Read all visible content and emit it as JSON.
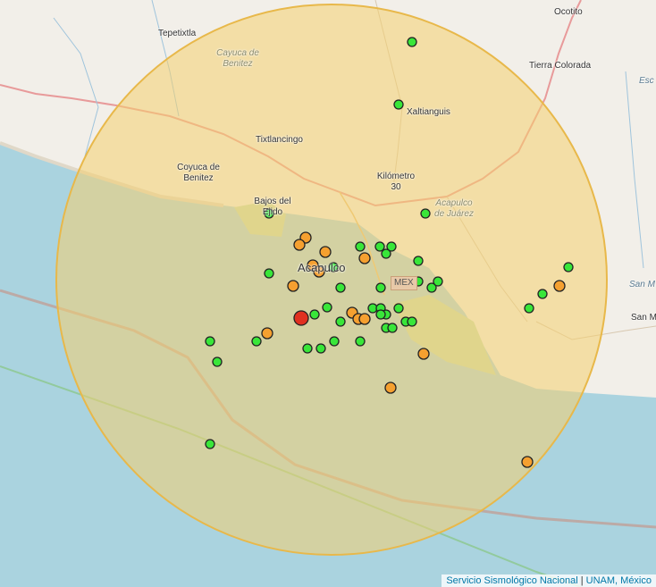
{
  "places": [
    {
      "name": "Ocotito",
      "key": "ocotito"
    },
    {
      "name": "Tepetixtla",
      "key": "tepetixtla"
    },
    {
      "name": "Cayuca de Benitez",
      "key": "cayuca-1",
      "style": "district"
    },
    {
      "name": "Tierra Colorada",
      "key": "tierra-colorada"
    },
    {
      "name": "Xaltianguis",
      "key": "xaltianguis"
    },
    {
      "name": "Tixtlancingo",
      "key": "tixtlancingo"
    },
    {
      "name": "Coyuca de Benitez",
      "key": "coyuca"
    },
    {
      "name": "Kilómetro 30",
      "key": "km30"
    },
    {
      "name": "Bajos del Ejido",
      "key": "bajos"
    },
    {
      "name": "Acapulco de Juárez",
      "key": "acapulco-district",
      "style": "district"
    },
    {
      "name": "Acapulco",
      "key": "acapulco"
    },
    {
      "name": "San M",
      "key": "san-m"
    },
    {
      "name": "San M",
      "key": "san-m-water",
      "style": "water"
    },
    {
      "name": "Esc",
      "key": "esc",
      "style": "water"
    }
  ],
  "mexico_shield": "MEX",
  "attribution": {
    "source": "Servicio Sismológico Nacional",
    "separator": " | ",
    "org": "UNAM, México"
  },
  "colors": {
    "sea": "#aad3df",
    "land": "#f2efe9",
    "radius_fill": "#f4d06f",
    "radius_stroke": "#e8b84a",
    "marker_green": "#39e639",
    "marker_orange": "#f5a030",
    "marker_red": "#e03020"
  },
  "markers": {
    "epicenter_color": "red",
    "green_count": 44,
    "orange_count": 20
  }
}
